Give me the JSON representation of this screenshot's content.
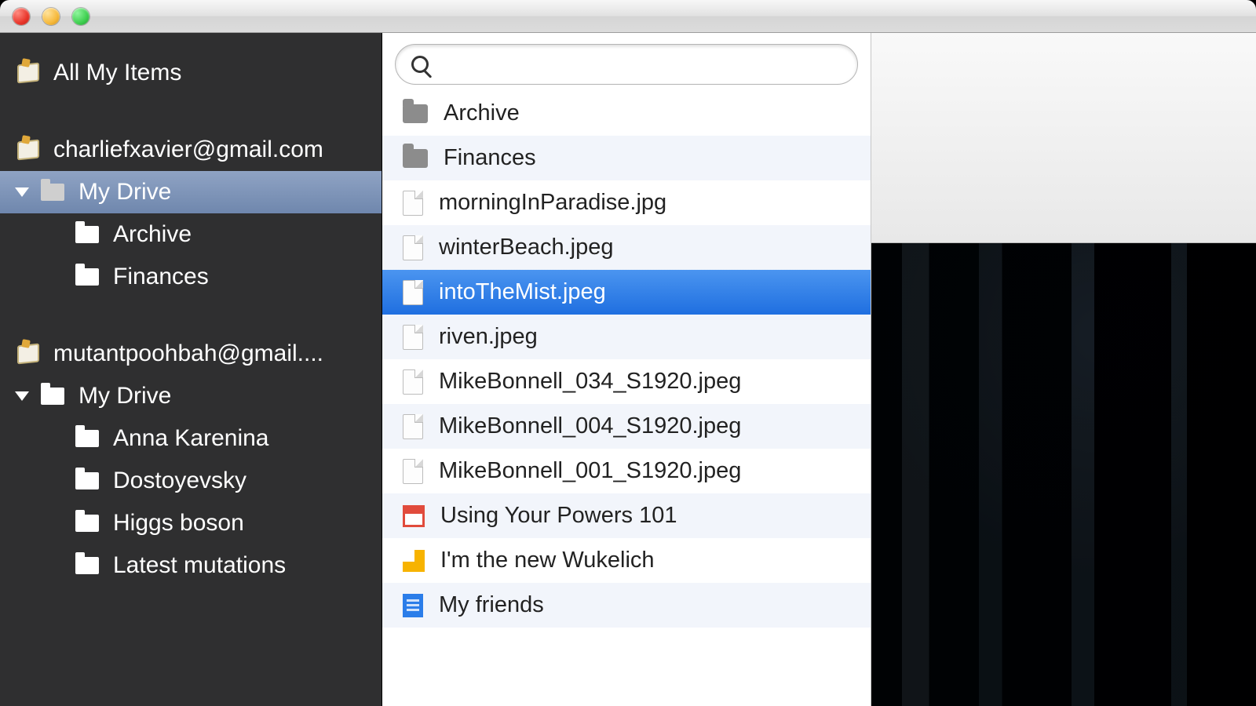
{
  "sidebar": {
    "allItemsLabel": "All My Items",
    "accounts": [
      {
        "email": "charliefxavier@gmail.com",
        "driveLabel": "My Drive",
        "driveSelected": true,
        "folders": [
          "Archive",
          "Finances"
        ]
      },
      {
        "email": "mutantpoohbah@gmail....",
        "driveLabel": "My Drive",
        "driveSelected": false,
        "folders": [
          "Anna Karenina",
          "Dostoyevsky",
          "Higgs boson",
          "Latest mutations"
        ]
      }
    ]
  },
  "search": {
    "value": "",
    "placeholder": ""
  },
  "files": [
    {
      "name": "Archive",
      "type": "folder",
      "selected": false
    },
    {
      "name": "Finances",
      "type": "folder",
      "selected": false
    },
    {
      "name": "morningInParadise.jpg",
      "type": "file",
      "selected": false
    },
    {
      "name": "winterBeach.jpeg",
      "type": "file",
      "selected": false
    },
    {
      "name": "intoTheMist.jpeg",
      "type": "file",
      "selected": true
    },
    {
      "name": "riven.jpeg",
      "type": "file",
      "selected": false
    },
    {
      "name": "MikeBonnell_034_S1920.jpeg",
      "type": "file",
      "selected": false
    },
    {
      "name": "MikeBonnell_004_S1920.jpeg",
      "type": "file",
      "selected": false
    },
    {
      "name": "MikeBonnell_001_S1920.jpeg",
      "type": "file",
      "selected": false
    },
    {
      "name": "Using Your Powers 101",
      "type": "gpres",
      "selected": false
    },
    {
      "name": "I'm the new Wukelich",
      "type": "gdraw",
      "selected": false
    },
    {
      "name": "My friends",
      "type": "gdoc",
      "selected": false
    }
  ]
}
